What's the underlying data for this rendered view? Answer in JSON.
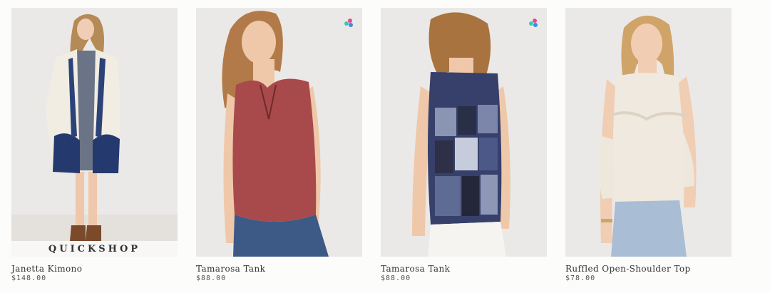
{
  "quickshop_label": "QUICKSHOP",
  "products": [
    {
      "name": "Janetta Kimono",
      "price": "$148.00",
      "image_icon": "product-photo-kimono",
      "primary_color": "#2b3a6b",
      "has_swatch_badge": false
    },
    {
      "name": "Tamarosa Tank",
      "price": "$88.00",
      "image_icon": "product-photo-red-tank",
      "primary_color": "#a84a4c",
      "has_swatch_badge": true
    },
    {
      "name": "Tamarosa Tank",
      "price": "$88.00",
      "image_icon": "product-photo-patchwork-tank",
      "primary_color": "#3b4466",
      "has_swatch_badge": true
    },
    {
      "name": "Ruffled Open-Shoulder Top",
      "price": "$78.00",
      "image_icon": "product-photo-ivory-top",
      "primary_color": "#efe9df",
      "has_swatch_badge": false
    }
  ]
}
